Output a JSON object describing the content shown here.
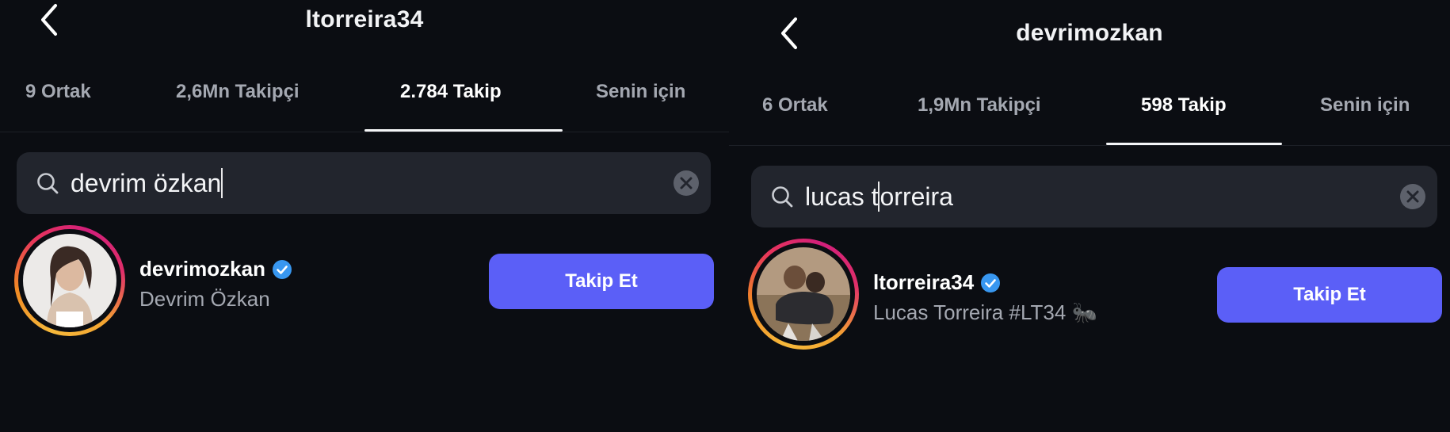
{
  "left": {
    "title": "ltorreira34",
    "tabs": [
      {
        "label": "9 Ortak"
      },
      {
        "label": "2,6Mn Takipçi"
      },
      {
        "label": "2.784 Takip"
      },
      {
        "label": "Senin için"
      }
    ],
    "search": {
      "query": "devrim özkan"
    },
    "result": {
      "username": "devrimozkan",
      "full_name": "Devrim Özkan",
      "button_label": "Takip Et"
    }
  },
  "right": {
    "title": "devrimozkan",
    "tabs": [
      {
        "label": "6 Ortak"
      },
      {
        "label": "1,9Mn Takipçi"
      },
      {
        "label": "598 Takip"
      },
      {
        "label": "Senin için"
      }
    ],
    "search": {
      "query_before_caret": "lucas t",
      "query_after_caret": "orreira"
    },
    "result": {
      "username": "ltorreira34",
      "full_name": "Lucas Torreira #LT34 🐜",
      "button_label": "Takip Et"
    }
  },
  "icons": {
    "back": "chevron-left-icon",
    "search": "search-icon",
    "clear": "clear-circle-icon",
    "verified": "verified-badge-icon"
  },
  "colors": {
    "background": "#0b0d12",
    "search_field": "#22252d",
    "follow_button": "#5b5ff7",
    "verified": "#3897f0",
    "muted_text": "#a4a8b1"
  }
}
